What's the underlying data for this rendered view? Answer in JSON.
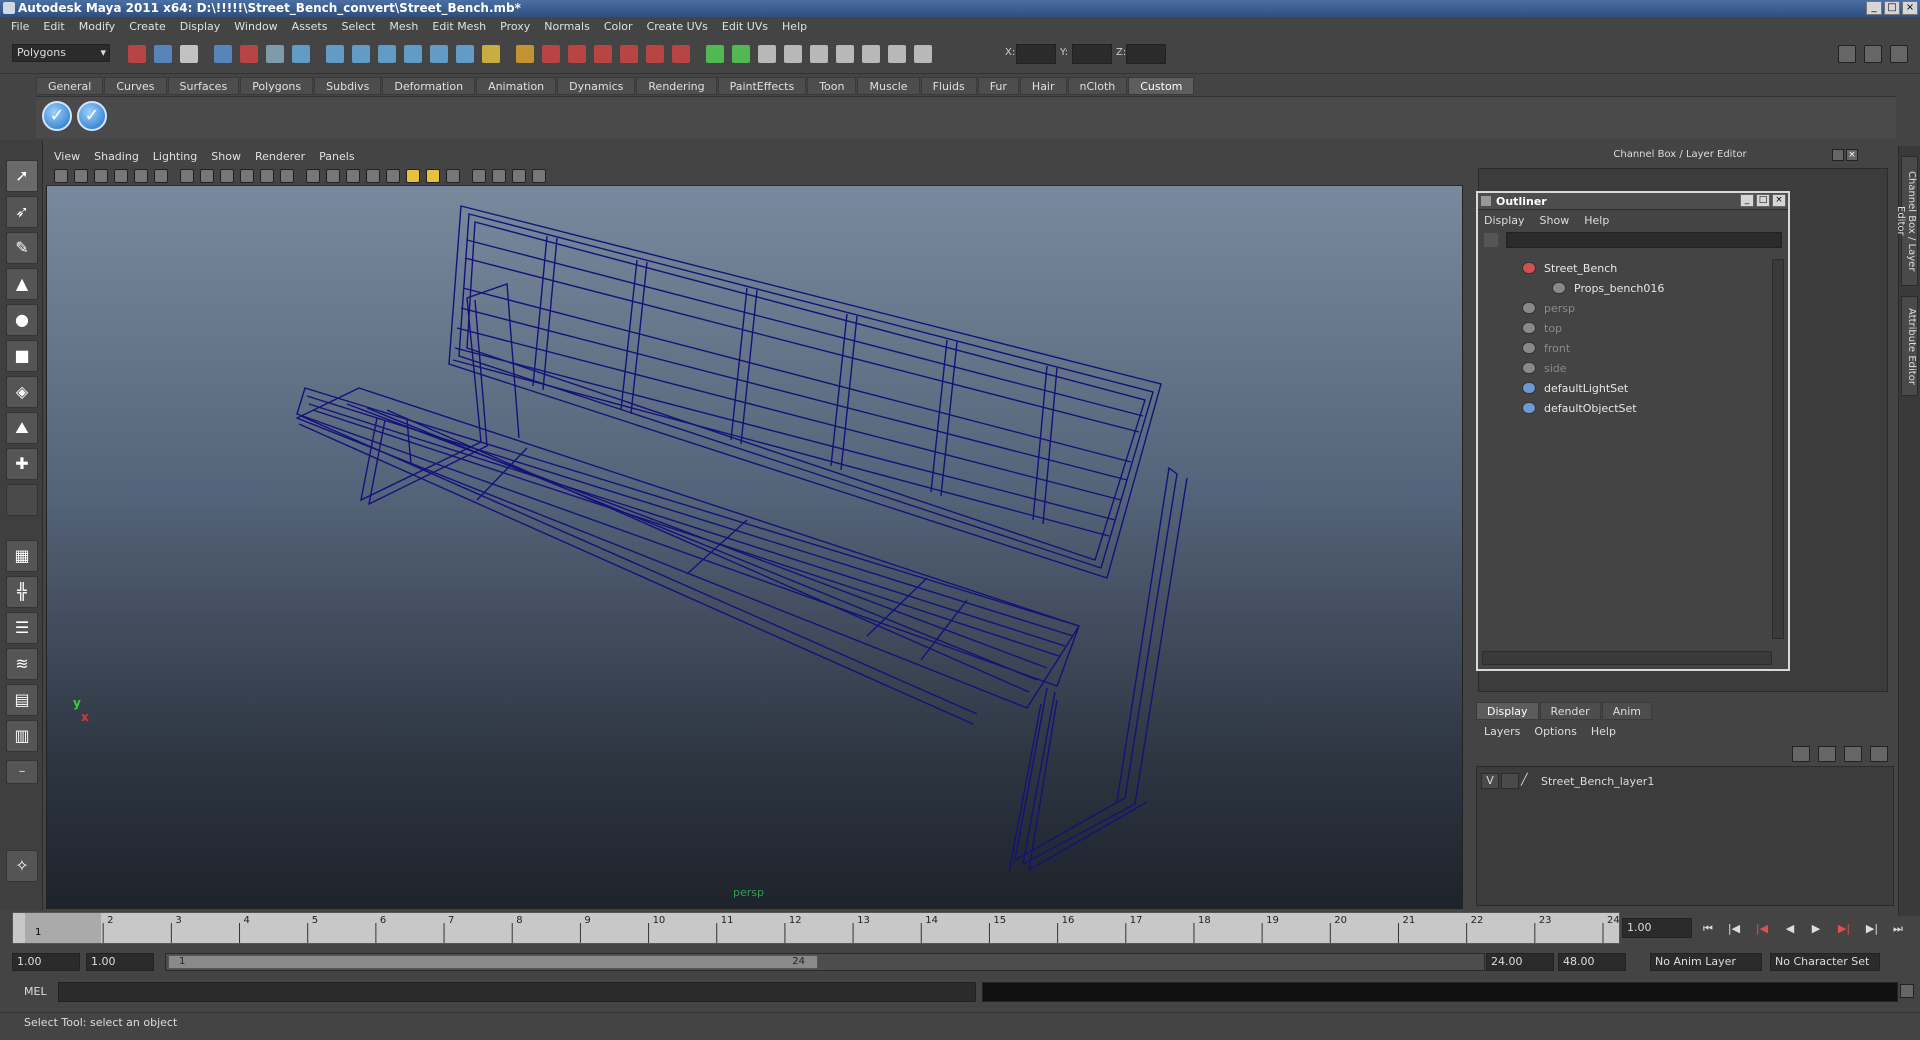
{
  "window": {
    "title": "Autodesk Maya 2011 x64: D:\\!!!!!\\Street_Bench_convert\\Street_Bench.mb*"
  },
  "menubar": [
    "File",
    "Edit",
    "Modify",
    "Create",
    "Display",
    "Window",
    "Assets",
    "Select",
    "Mesh",
    "Edit Mesh",
    "Proxy",
    "Normals",
    "Color",
    "Create UVs",
    "Edit UVs",
    "Help"
  ],
  "statusline": {
    "mode": "Polygons",
    "x_label": "X:",
    "y_label": "Y:",
    "z_label": "Z:"
  },
  "shelf": {
    "tabs": [
      "General",
      "Curves",
      "Surfaces",
      "Polygons",
      "Subdivs",
      "Deformation",
      "Animation",
      "Dynamics",
      "Rendering",
      "PaintEffects",
      "Toon",
      "Muscle",
      "Fluids",
      "Fur",
      "Hair",
      "nCloth",
      "Custom"
    ],
    "active": "Custom"
  },
  "viewport": {
    "menu": [
      "View",
      "Shading",
      "Lighting",
      "Show",
      "Renderer",
      "Panels"
    ],
    "camera_label": "persp",
    "axis_y": "y",
    "axis_x": "x"
  },
  "channel_box": {
    "header": "Channel Box / Layer Editor"
  },
  "side_tabs": [
    "Channel Box / Layer Editor",
    "Attribute Editor"
  ],
  "outliner": {
    "title": "Outliner",
    "menu": [
      "Display",
      "Show",
      "Help"
    ],
    "items": [
      {
        "label": "Street_Bench",
        "dim": false
      },
      {
        "label": "Props_bench016",
        "dim": false
      },
      {
        "label": "persp",
        "dim": true
      },
      {
        "label": "top",
        "dim": true
      },
      {
        "label": "front",
        "dim": true
      },
      {
        "label": "side",
        "dim": true
      },
      {
        "label": "defaultLightSet",
        "dim": false
      },
      {
        "label": "defaultObjectSet",
        "dim": false
      }
    ]
  },
  "layer_editor": {
    "tabs": [
      "Display",
      "Render",
      "Anim"
    ],
    "active": "Display",
    "menu": [
      "Layers",
      "Options",
      "Help"
    ],
    "layer": {
      "visible": "V",
      "name": "Street_Bench_layer1"
    }
  },
  "timeline": {
    "ticks": [
      "1",
      "2",
      "3",
      "4",
      "5",
      "6",
      "7",
      "8",
      "9",
      "10",
      "11",
      "12",
      "13",
      "14",
      "15",
      "16",
      "17",
      "18",
      "19",
      "20",
      "21",
      "22",
      "23",
      "24"
    ],
    "current_frame": "1.00",
    "marker": "1"
  },
  "range": {
    "start": "1.00",
    "start2": "1.00",
    "thumb_start": "1",
    "thumb_end": "24",
    "end": "24.00",
    "end2": "48.00",
    "anim_layer": "No Anim Layer",
    "char_set": "No Character Set"
  },
  "cmdline": {
    "label": "MEL"
  },
  "helpline": {
    "text": "Select Tool: select an object"
  }
}
